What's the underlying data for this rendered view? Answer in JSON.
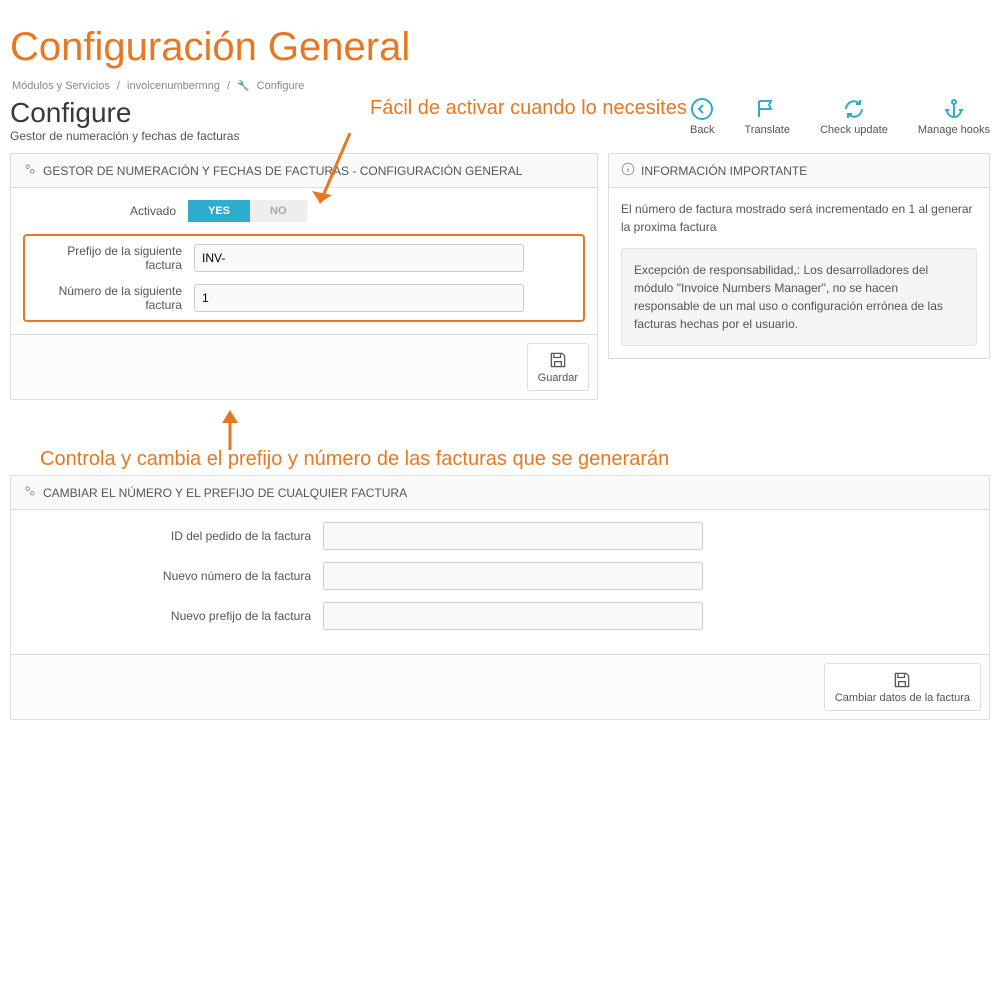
{
  "annotation": {
    "title": "Configuración General",
    "sub1": "Fácil de activar cuando lo necesites",
    "sub2": "Controla y cambia el prefijo y número de las facturas que se generarán"
  },
  "breadcrumb": {
    "item1": "Módulos y Servicios",
    "item2": "invoicenumbermng",
    "item3": "Configure"
  },
  "page": {
    "title": "Configure",
    "subtitle": "Gestor de numeración y fechas de facturas"
  },
  "toolbar": {
    "back": "Back",
    "translate": "Translate",
    "check_update": "Check update",
    "manage_hooks": "Manage hooks"
  },
  "panel1": {
    "heading": "GESTOR DE NUMERACIÓN Y FECHAS DE FACTURAS - CONFIGURACIÓN GENERAL",
    "activado_label": "Activado",
    "yes": "YES",
    "no": "NO",
    "prefijo_label": "Prefijo de la siguiente factura",
    "prefijo_value": "INV-",
    "numero_label": "Número de la siguiente factura",
    "numero_value": "1",
    "save": "Guardar"
  },
  "panel2": {
    "heading": "INFORMACIÓN IMPORTANTE",
    "text1": "El número de factura mostrado será incrementado en 1 al generar la proxima factura",
    "text2": "Excepción de responsabilidad,: Los desarrolladores del módulo \"Invoice Numbers Manager\", no se hacen responsable de un mal uso o configuración errónea de las facturas hechas por el usuario."
  },
  "panel3": {
    "heading": "CAMBIAR EL NÚMERO Y EL PREFIJO DE CUALQUIER FACTURA",
    "id_label": "ID del pedido de la factura",
    "numero_label": "Nuevo número de la factura",
    "prefijo_label": "Nuevo prefijo de la factura",
    "save": "Cambiar datos de la factura"
  }
}
